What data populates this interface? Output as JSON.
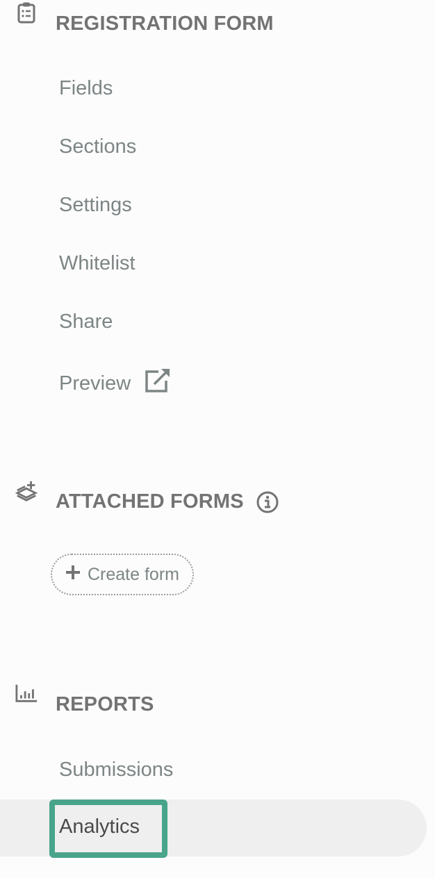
{
  "sections": {
    "registration": {
      "title": "REGISTRATION FORM",
      "icon": "clipboard-list-icon",
      "items": [
        {
          "label": "Fields"
        },
        {
          "label": "Sections"
        },
        {
          "label": "Settings"
        },
        {
          "label": "Whitelist"
        },
        {
          "label": "Share"
        },
        {
          "label": "Preview",
          "icon": "external-link-icon"
        }
      ]
    },
    "attached": {
      "title": "ATTACHED FORMS",
      "icon": "layers-plus-icon",
      "info_icon": "info-icon",
      "create_button": "Create form"
    },
    "reports": {
      "title": "REPORTS",
      "icon": "bar-chart-icon",
      "items": [
        {
          "label": "Submissions"
        },
        {
          "label": "Analytics",
          "active": true
        }
      ]
    }
  },
  "colors": {
    "accent": "#48a48b",
    "text": "#7d8585",
    "heading": "#737373"
  }
}
